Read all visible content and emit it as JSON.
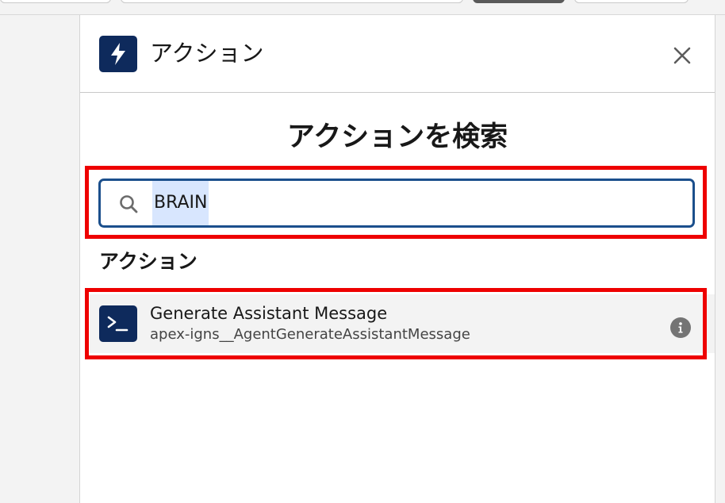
{
  "header": {
    "title": "アクション",
    "icon": "lightning-bolt-icon",
    "close_icon": "close-icon"
  },
  "search": {
    "heading": "アクションを検索",
    "value": "BRAIN",
    "icon": "search-icon"
  },
  "results": {
    "section_label": "アクション",
    "items": [
      {
        "title": "Generate Assistant Message",
        "api_name": "apex-igns__AgentGenerateAssistantMessage",
        "icon": "apex-terminal-icon",
        "info_icon": "info-icon"
      }
    ]
  },
  "colors": {
    "icon_bg": "#0e2a5c",
    "highlight": "#ee0000",
    "search_border": "#1b4f8c",
    "selection": "#d8e6fe"
  }
}
